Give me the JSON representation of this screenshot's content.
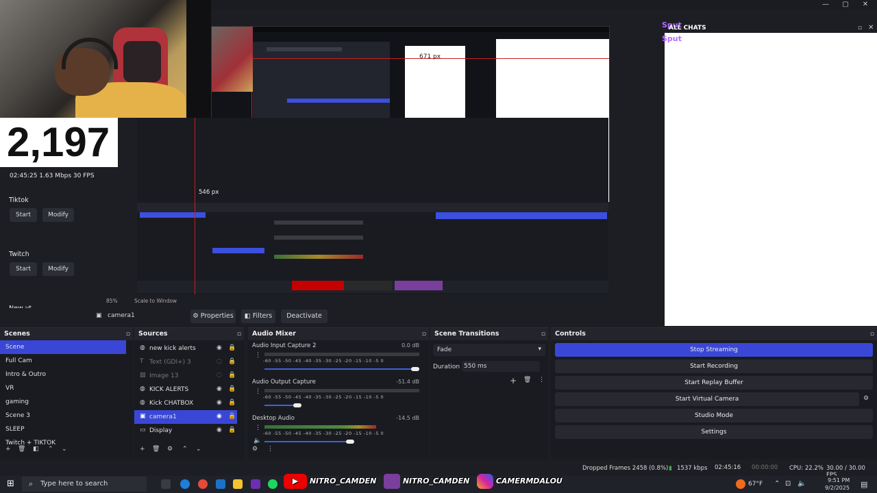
{
  "window": {
    "minimize": "—",
    "maximize": "▢",
    "close": "✕"
  },
  "overlay": {
    "viewer_count": "2,197",
    "stream_stats": "02:45:25   1.63 Mbps  30 FPS",
    "tiktok_label": "Tiktok",
    "twitch_label": "Twitch",
    "newyt_label": "New yt",
    "start_label": "Start",
    "modify_label": "Modify"
  },
  "preview": {
    "dim_label_h": "671 px",
    "dim_label_v": "546 px",
    "zoom": "85%",
    "scale_mode": "Scale to Window"
  },
  "chat": {
    "user1": "Sput",
    "all_chats": "ALL CHATS",
    "user2": "Sput"
  },
  "source_toolbar": {
    "selected_source": "camera1",
    "properties": "Properties",
    "filters": "Filters",
    "deactivate": "Deactivate"
  },
  "scenes": {
    "title": "Scenes",
    "items": [
      "Scene",
      "Full Cam",
      "Intro & Outro",
      "VR",
      "gaming",
      "Scene 3",
      "SLEEP",
      "Twitch + TIKTOK"
    ]
  },
  "sources": {
    "title": "Sources",
    "items": [
      {
        "label": "new kick alerts",
        "icon": "globe-icon"
      },
      {
        "label": "Text (GDI+) 3",
        "icon": "text-icon"
      },
      {
        "label": "Image 13",
        "icon": "image-icon"
      },
      {
        "label": "KICK ALERTS",
        "icon": "globe-icon"
      },
      {
        "label": "Kick CHATBOX",
        "icon": "globe-icon"
      },
      {
        "label": "camera1",
        "icon": "camera-icon"
      },
      {
        "label": "Display",
        "icon": "display-icon"
      }
    ]
  },
  "mixer": {
    "title": "Audio Mixer",
    "ticks": "-60 -55 -50 -45 -40 -35 -30 -25 -20 -15 -10  -5   0",
    "channels": [
      {
        "name": "Audio Input Capture 2",
        "db": "0.0 dB",
        "level": 0.0
      },
      {
        "name": "Audio Output Capture",
        "db": "-51.4 dB",
        "level": 0.0
      },
      {
        "name": "Desktop Audio",
        "db": "-14.5 dB",
        "level": 0.72
      }
    ]
  },
  "transitions": {
    "title": "Scene Transitions",
    "type": "Fade",
    "duration_label": "Duration",
    "duration_value": "550 ms"
  },
  "controls": {
    "title": "Controls",
    "buttons": [
      "Stop Streaming",
      "Start Recording",
      "Start Replay Buffer",
      "Start Virtual Camera",
      "Studio Mode",
      "Settings"
    ]
  },
  "status": {
    "dropped": "Dropped Frames 2458 (0.8%)",
    "bitrate": "1537 kbps",
    "stream_time": "02:45:16",
    "rec_time": "00:00:00",
    "cpu": "CPU: 22.2%",
    "fps": "30.00 / 30.00 FPS"
  },
  "taskbar": {
    "search_placeholder": "Type here to search",
    "banner1": "NITRO_CAMDEN",
    "banner2": "NITRO_CAMDEN",
    "banner3": "CAMERMDALOU",
    "temp": "67°F",
    "time": "9:51 PM",
    "date": "9/2/2025"
  },
  "colors": {
    "accent": "#3a47d6",
    "panel": "#1a1b21",
    "header": "#23242c"
  }
}
